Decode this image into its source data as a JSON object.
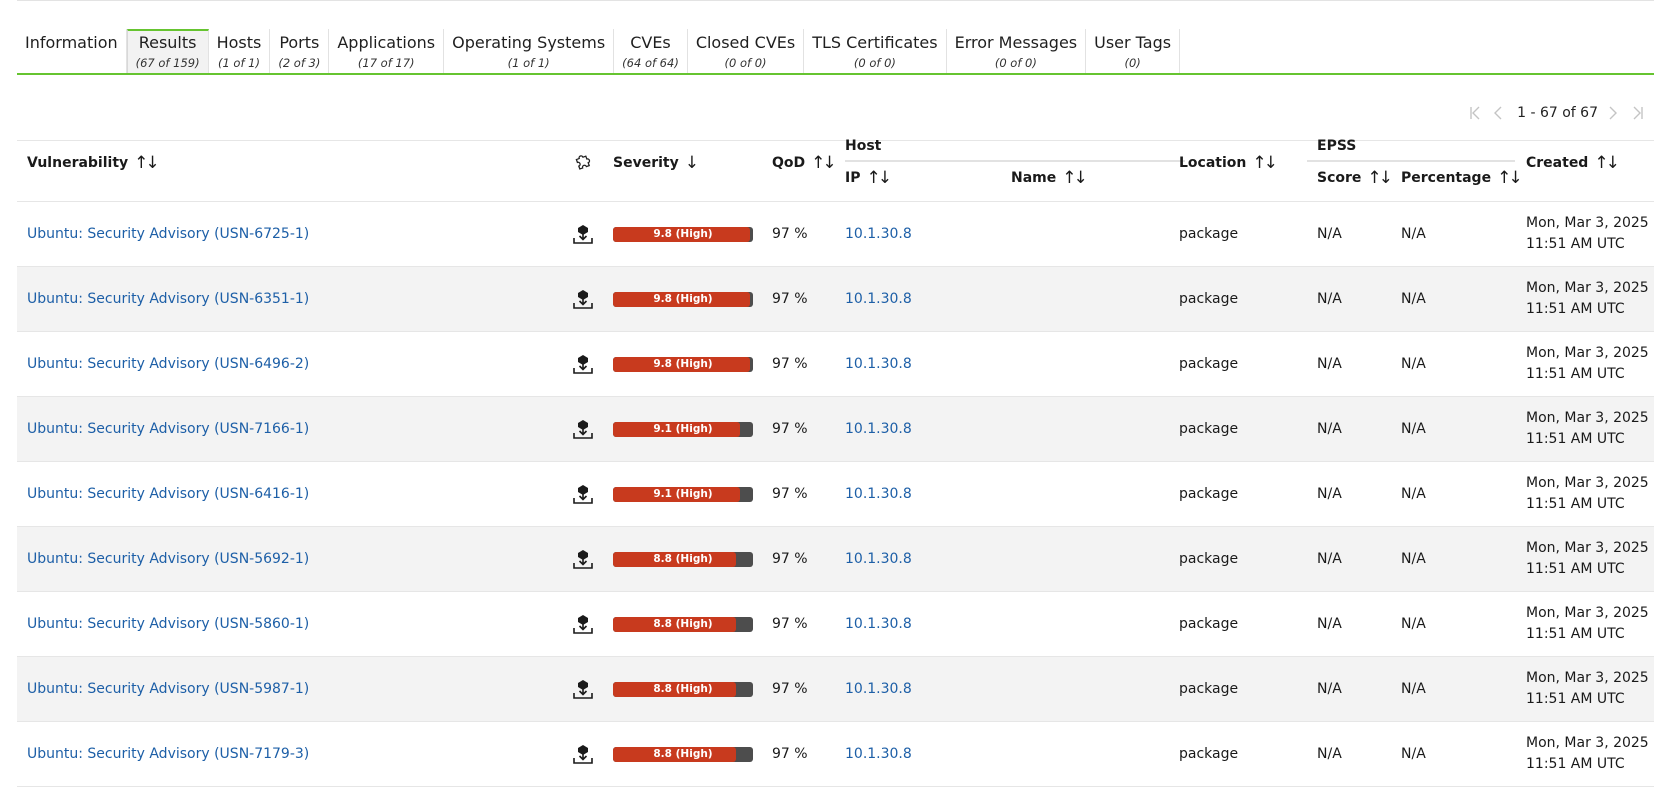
{
  "tabs": [
    {
      "label": "Information",
      "count": ""
    },
    {
      "label": "Results",
      "count": "(67 of 159)",
      "active": true
    },
    {
      "label": "Hosts",
      "count": "(1 of 1)"
    },
    {
      "label": "Ports",
      "count": "(2 of 3)"
    },
    {
      "label": "Applications",
      "count": "(17 of 17)"
    },
    {
      "label": "Operating Systems",
      "count": "(1 of 1)"
    },
    {
      "label": "CVEs",
      "count": "(64 of 64)"
    },
    {
      "label": "Closed CVEs",
      "count": "(0 of 0)"
    },
    {
      "label": "TLS Certificates",
      "count": "(0 of 0)"
    },
    {
      "label": "Error Messages",
      "count": "(0 of 0)"
    },
    {
      "label": "User Tags",
      "count": "(0)"
    }
  ],
  "pagination": {
    "text": "1 - 67 of 67"
  },
  "columns": {
    "vulnerability": "Vulnerability",
    "severity": "Severity",
    "qod": "QoD",
    "host": "Host",
    "ip": "IP",
    "name": "Name",
    "location": "Location",
    "epss": "EPSS",
    "score": "Score",
    "percentage": "Percentage",
    "created": "Created"
  },
  "icons": {
    "sort": "sort-both-icon",
    "sort_down": "sort-down-icon",
    "solution_type": "puzzle-icon",
    "row_solution": "download-package-icon"
  },
  "colors": {
    "accent": "#66c430",
    "high": "#c83a1e",
    "link": "#1d5fa7"
  },
  "rows": [
    {
      "vulnerability": "Ubuntu: Security Advisory (USN-6725-1)",
      "severity": "9.8 (High)",
      "severity_value": 9.8,
      "qod": "97 %",
      "ip": "10.1.30.8",
      "name": "",
      "location": "package",
      "score": "N/A",
      "percentage": "N/A",
      "created_date": "Mon, Mar 3, 2025",
      "created_time": "11:51 AM UTC"
    },
    {
      "vulnerability": "Ubuntu: Security Advisory (USN-6351-1)",
      "severity": "9.8 (High)",
      "severity_value": 9.8,
      "qod": "97 %",
      "ip": "10.1.30.8",
      "name": "",
      "location": "package",
      "score": "N/A",
      "percentage": "N/A",
      "created_date": "Mon, Mar 3, 2025",
      "created_time": "11:51 AM UTC"
    },
    {
      "vulnerability": "Ubuntu: Security Advisory (USN-6496-2)",
      "severity": "9.8 (High)",
      "severity_value": 9.8,
      "qod": "97 %",
      "ip": "10.1.30.8",
      "name": "",
      "location": "package",
      "score": "N/A",
      "percentage": "N/A",
      "created_date": "Mon, Mar 3, 2025",
      "created_time": "11:51 AM UTC"
    },
    {
      "vulnerability": "Ubuntu: Security Advisory (USN-7166-1)",
      "severity": "9.1 (High)",
      "severity_value": 9.1,
      "qod": "97 %",
      "ip": "10.1.30.8",
      "name": "",
      "location": "package",
      "score": "N/A",
      "percentage": "N/A",
      "created_date": "Mon, Mar 3, 2025",
      "created_time": "11:51 AM UTC"
    },
    {
      "vulnerability": "Ubuntu: Security Advisory (USN-6416-1)",
      "severity": "9.1 (High)",
      "severity_value": 9.1,
      "qod": "97 %",
      "ip": "10.1.30.8",
      "name": "",
      "location": "package",
      "score": "N/A",
      "percentage": "N/A",
      "created_date": "Mon, Mar 3, 2025",
      "created_time": "11:51 AM UTC"
    },
    {
      "vulnerability": "Ubuntu: Security Advisory (USN-5692-1)",
      "severity": "8.8 (High)",
      "severity_value": 8.8,
      "qod": "97 %",
      "ip": "10.1.30.8",
      "name": "",
      "location": "package",
      "score": "N/A",
      "percentage": "N/A",
      "created_date": "Mon, Mar 3, 2025",
      "created_time": "11:51 AM UTC"
    },
    {
      "vulnerability": "Ubuntu: Security Advisory (USN-5860-1)",
      "severity": "8.8 (High)",
      "severity_value": 8.8,
      "qod": "97 %",
      "ip": "10.1.30.8",
      "name": "",
      "location": "package",
      "score": "N/A",
      "percentage": "N/A",
      "created_date": "Mon, Mar 3, 2025",
      "created_time": "11:51 AM UTC"
    },
    {
      "vulnerability": "Ubuntu: Security Advisory (USN-5987-1)",
      "severity": "8.8 (High)",
      "severity_value": 8.8,
      "qod": "97 %",
      "ip": "10.1.30.8",
      "name": "",
      "location": "package",
      "score": "N/A",
      "percentage": "N/A",
      "created_date": "Mon, Mar 3, 2025",
      "created_time": "11:51 AM UTC"
    },
    {
      "vulnerability": "Ubuntu: Security Advisory (USN-7179-3)",
      "severity": "8.8 (High)",
      "severity_value": 8.8,
      "qod": "97 %",
      "ip": "10.1.30.8",
      "name": "",
      "location": "package",
      "score": "N/A",
      "percentage": "N/A",
      "created_date": "Mon, Mar 3, 2025",
      "created_time": "11:51 AM UTC"
    }
  ]
}
